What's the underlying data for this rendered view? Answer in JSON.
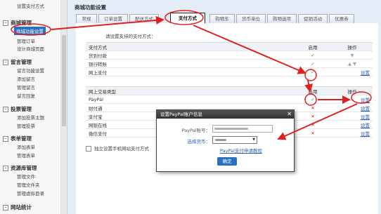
{
  "sidebar": {
    "top_item": "设置支付方式",
    "groups": [
      {
        "label": "商城管理",
        "items": [
          {
            "label": "商城功能设置",
            "active": true
          },
          {
            "label": "管理订单",
            "active": false
          },
          {
            "label": "设计商城页面",
            "active": false
          }
        ]
      },
      {
        "label": "留言管理",
        "items": [
          {
            "label": "留言功能设置",
            "active": false
          },
          {
            "label": "添加留言",
            "active": false
          },
          {
            "label": "管理留言",
            "active": false
          },
          {
            "label": "留言回复",
            "active": false
          }
        ]
      },
      {
        "label": "投票管理",
        "items": [
          {
            "label": "添加投票主题",
            "active": false
          },
          {
            "label": "管理投票",
            "active": false
          }
        ]
      },
      {
        "label": "表单管理",
        "items": [
          {
            "label": "添加表单",
            "active": false
          },
          {
            "label": "管理表单",
            "active": false
          }
        ]
      },
      {
        "label": "资源库管理",
        "items": [
          {
            "label": "管理文件",
            "active": false
          },
          {
            "label": "管理文件夹",
            "active": false
          },
          {
            "label": "管理虚拟目录",
            "active": false
          }
        ]
      },
      {
        "label": "网站统计",
        "items": []
      }
    ]
  },
  "main": {
    "title": "商城功能设置",
    "tabs": [
      {
        "label": "常规",
        "active": false
      },
      {
        "label": "订单设置",
        "active": false
      },
      {
        "label": "配送方式",
        "active": false
      },
      {
        "label": "支付方式",
        "active": true
      },
      {
        "label": "购物车",
        "active": false
      },
      {
        "label": "货币单位",
        "active": false
      },
      {
        "label": "购物选项",
        "active": false
      },
      {
        "label": "促销活动",
        "active": false
      },
      {
        "label": "优惠券",
        "active": false
      }
    ],
    "prompt": "请设置支持的支付方式：",
    "offline_table": {
      "headers": [
        "支付方式",
        "启用",
        "操作"
      ],
      "rows": [
        {
          "name": "货到付款",
          "enabled": true,
          "action": ""
        },
        {
          "name": "银行转账",
          "enabled": true,
          "action": ""
        },
        {
          "name": "网上支付",
          "enabled": true,
          "action": "设置"
        }
      ]
    },
    "online_table": {
      "headers": [
        "网上交易类型",
        "启用",
        "操作"
      ],
      "rows": [
        {
          "name": "PayPal",
          "enabled": true,
          "action": "设置"
        },
        {
          "name": "财付通",
          "enabled": false,
          "action": "设置"
        },
        {
          "name": "支付宝",
          "enabled": false,
          "action": "设置"
        },
        {
          "name": "网银在线",
          "enabled": false,
          "action": "设置"
        },
        {
          "name": "微信支付",
          "enabled": false,
          "action": "设置"
        }
      ]
    },
    "mobile_option": "独立设置手机网站支付方式"
  },
  "dialog": {
    "title": "设置PayPal账户信息",
    "account_label": "PayPal账号：",
    "currency_label": "选择货币：",
    "link": "PayPal支付申请教程",
    "ok": "确定"
  },
  "icons": {
    "check": "✓",
    "cross": "✕",
    "up": "▲",
    "down": "▼",
    "toggle": "−"
  },
  "colors": {
    "accent": "#2a6fc0",
    "annotation": "#e02020",
    "check": "#2a8f2a",
    "cross": "#c42020"
  }
}
